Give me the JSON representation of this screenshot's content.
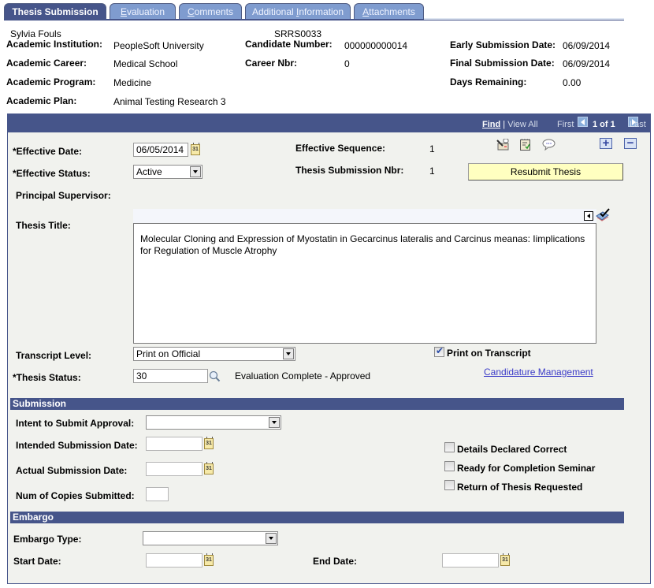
{
  "tabs": [
    {
      "label": "Thesis Submission",
      "active": true
    },
    {
      "label": "Evaluation",
      "underline_char": "E",
      "rest": "valuation"
    },
    {
      "label": "Comments",
      "underline_char": "C",
      "rest": "omments"
    },
    {
      "label": "Additional Information",
      "prefix": "Additional ",
      "underline_char": "I",
      "rest": "nformation"
    },
    {
      "label": "Attachments",
      "underline_char": "A",
      "rest": "ttachments"
    }
  ],
  "header": {
    "student_name": "Sylvia Fouls",
    "student_id": "SRRS0033",
    "academic_institution_label": "Academic Institution:",
    "academic_institution": "PeopleSoft University",
    "academic_career_label": "Academic Career:",
    "academic_career": "Medical School",
    "academic_program_label": "Academic Program:",
    "academic_program": "Medicine",
    "academic_plan_label": "Academic Plan:",
    "academic_plan": "Animal Testing Research 3",
    "candidate_number_label": "Candidate Number:",
    "candidate_number": "000000000014",
    "career_nbr_label": "Career Nbr:",
    "career_nbr": "0",
    "early_submission_label": "Early Submission Date:",
    "early_submission_date": "06/09/2014",
    "final_submission_label": "Final Submission Date:",
    "final_submission_date": "06/09/2014",
    "days_remaining_label": "Days Remaining:",
    "days_remaining": "0.00"
  },
  "navigation": {
    "find": "Find",
    "separator": "|",
    "view_all": "View All",
    "first": "First",
    "counter": "1 of 1",
    "last": "Last"
  },
  "form": {
    "effective_date_label": "*Effective Date:",
    "effective_date": "06/05/2014",
    "effective_status_label": "*Effective Status:",
    "effective_status": "Active",
    "effective_sequence_label": "Effective Sequence:",
    "effective_sequence": "1",
    "thesis_submission_nbr_label": "Thesis Submission Nbr:",
    "thesis_submission_nbr": "1",
    "resubmit_button": "Resubmit Thesis",
    "principal_supervisor_label": "Principal Supervisor:",
    "thesis_title_label": "Thesis Title:",
    "thesis_title": "Molecular Cloning and Expression of Myostatin in Gecarcinus lateralis and Carcinus meanas: Iimplications for Regulation of Muscle Atrophy",
    "transcript_level_label": "Transcript Level:",
    "transcript_level": "Print on Official",
    "print_on_transcript_label": "Print on Transcript",
    "print_on_transcript": true,
    "thesis_status_label": "*Thesis Status:",
    "thesis_status": "30",
    "thesis_status_desc": "Evaluation Complete - Approved",
    "candidature_link": "Candidature Management",
    "calendar_glyph": "31"
  },
  "submission": {
    "title": "Submission",
    "intent_label": "Intent to Submit Approval:",
    "intent_value": "",
    "intended_date_label": "Intended Submission Date:",
    "intended_date": "",
    "actual_date_label": "Actual Submission Date:",
    "actual_date": "",
    "copies_label": "Num of Copies Submitted:",
    "copies": "",
    "details_declared_label": "Details Declared Correct",
    "details_declared": false,
    "ready_seminar_label": "Ready for Completion Seminar",
    "ready_seminar": false,
    "return_thesis_label": "Return of Thesis Requested",
    "return_thesis": false
  },
  "embargo": {
    "title": "Embargo",
    "type_label": "Embargo Type:",
    "type_value": "",
    "start_label": "Start Date:",
    "start_date": "",
    "end_label": "End Date:",
    "end_date": ""
  },
  "colors": {
    "header_blue": "#46558a",
    "inactive_tab": "#7f9ccf",
    "panel_bg": "#f1f2ee",
    "button_yellow": "#ffffc0",
    "link": "#3b3bc8"
  }
}
